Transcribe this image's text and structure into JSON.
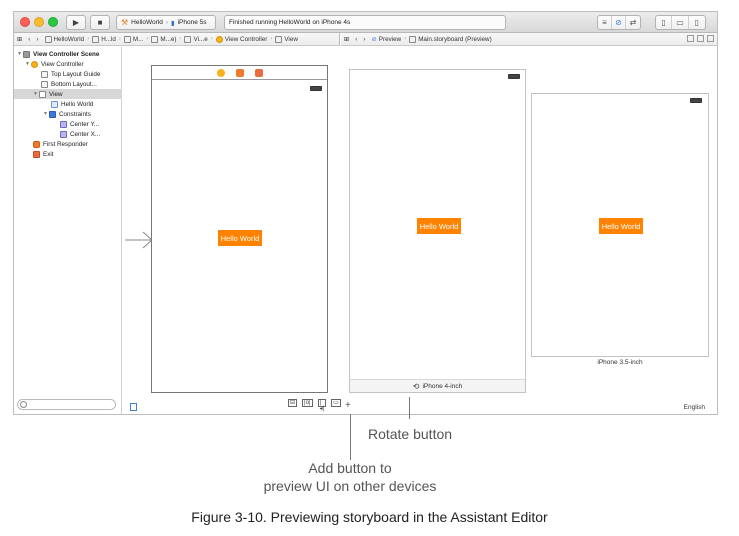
{
  "toolbar": {
    "scheme_app": "HelloWorld",
    "scheme_device": "iPhone 5s",
    "status": "Finished running HelloWorld on iPhone 4s"
  },
  "jumpbar_left": {
    "items": [
      "HelloWorld",
      "H...ld",
      "M...",
      "M...e)",
      "Vi...e",
      "View Controller",
      "View"
    ]
  },
  "jumpbar_right": {
    "preview_label": "Preview",
    "file_label": "Main.storyboard (Preview)"
  },
  "outline": {
    "scene": "View Controller Scene",
    "view_controller": "View Controller",
    "top_guide": "Top Layout Guide",
    "bottom_guide": "Bottom Layout...",
    "view": "View",
    "hello_label": "Hello World",
    "constraints": "Constraints",
    "center_y": "Center Y...",
    "center_x": "Center X...",
    "first_responder": "First Responder",
    "exit": "Exit"
  },
  "canvas": {
    "label_text": "Hello World"
  },
  "preview": {
    "label_4inch": "Hello World",
    "label_35inch": "Hello World",
    "device_4inch": "iPhone 4-inch",
    "device_35inch": "iPhone 3.5-inch",
    "add_symbol": "+",
    "language": "English"
  },
  "callouts": {
    "rotate": "Rotate button",
    "add_line1": "Add button to",
    "add_line2": "preview UI on other devices"
  },
  "caption": "Figure 3-10. Previewing storyboard in the Assistant Editor",
  "colors": {
    "label_bg": "#ff8300",
    "selection": "#d7d7d7",
    "accent": "#3f7fd8"
  }
}
